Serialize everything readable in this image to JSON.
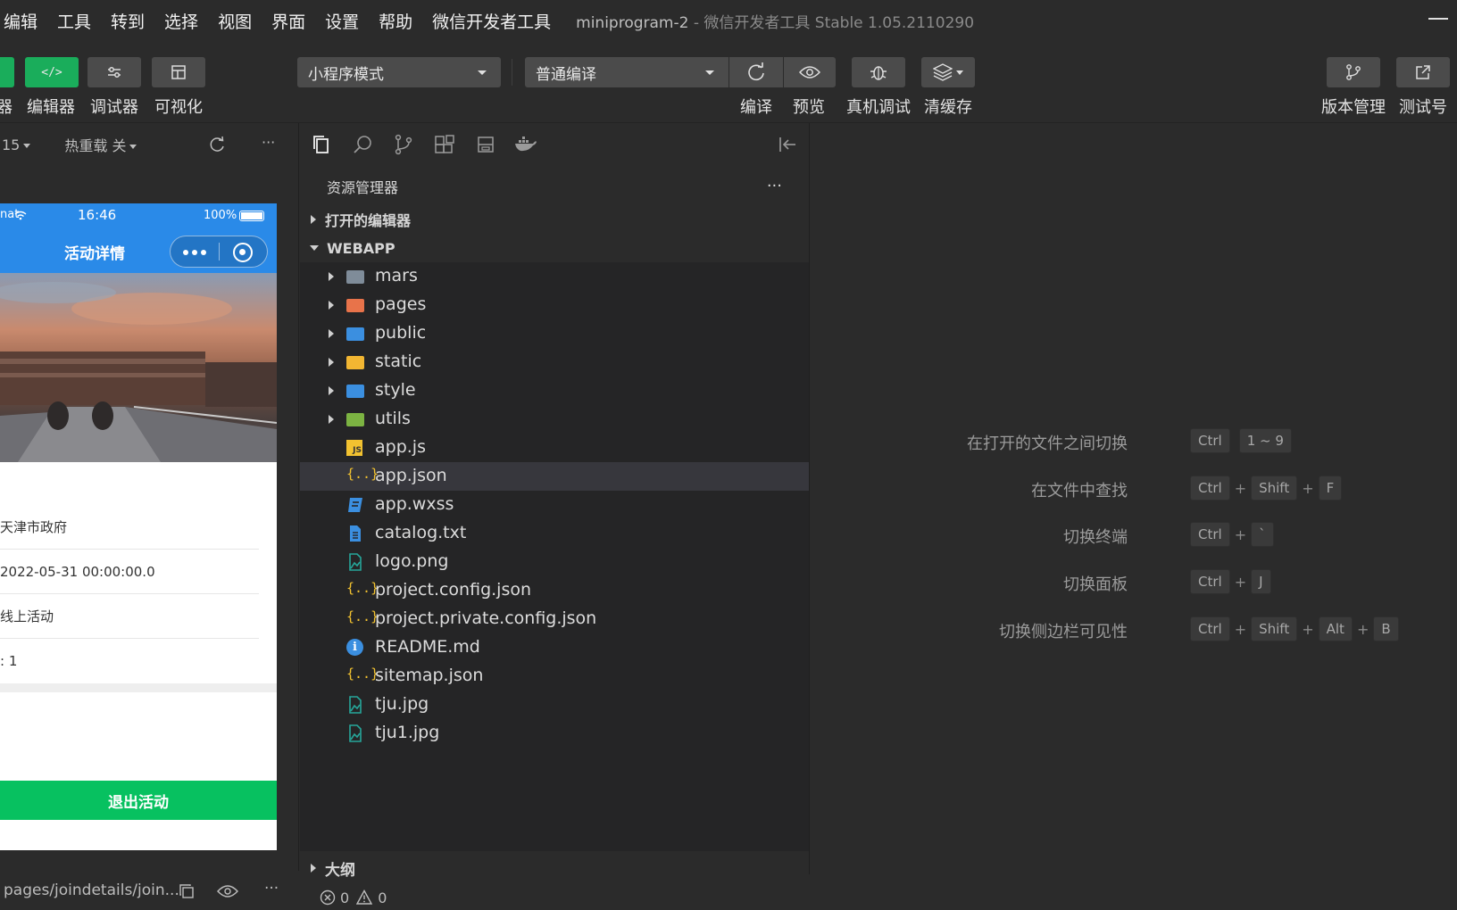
{
  "menu": [
    "编辑",
    "工具",
    "转到",
    "选择",
    "视图",
    "界面",
    "设置",
    "帮助",
    "微信开发者工具"
  ],
  "window": {
    "project": "miniprogram-2",
    "separator": "-",
    "app": "微信开发者工具 Stable 1.05.2110290"
  },
  "toolbar": {
    "simulator_label": "器",
    "editor_label": "编辑器",
    "debugger_label": "调试器",
    "visual_label": "可视化",
    "mode_select": "小程序模式",
    "compile_select": "普通编译",
    "compile_label": "编译",
    "preview_label": "预览",
    "device_debug_label": "真机调试",
    "clear_cache_label": "清缓存",
    "version_label": "版本管理",
    "test_label": "测试号",
    "editor_icon": "</>"
  },
  "simulator": {
    "zoom": "15",
    "hot_reload": "热重载 关",
    "more": "···",
    "status": {
      "carrier": "nat",
      "time": "16:46",
      "battery": "100%"
    },
    "page_title": "活动详情",
    "rows": [
      "天津市政府",
      "2022-05-31 00:00:00.0",
      "线上活动",
      ": 1"
    ],
    "exit_button": "退出活动",
    "path": "pages/joindetails/join..."
  },
  "explorer": {
    "title": "资源管理器",
    "more": "···",
    "open_editors": "打开的编辑器",
    "root": "WEBAPP",
    "folders": [
      {
        "name": "mars",
        "color": "#7f8c99"
      },
      {
        "name": "pages",
        "color": "#e8734a"
      },
      {
        "name": "public",
        "color": "#3b8fe0"
      },
      {
        "name": "static",
        "color": "#f2b632"
      },
      {
        "name": "style",
        "color": "#3b8fe0"
      },
      {
        "name": "utils",
        "color": "#7cb342"
      }
    ],
    "files": [
      "app.js",
      "app.json",
      "app.wxss",
      "catalog.txt",
      "logo.png",
      "project.config.json",
      "project.private.config.json",
      "README.md",
      "sitemap.json",
      "tju.jpg",
      "tju1.jpg"
    ],
    "outline": "大纲",
    "errors": "0",
    "warnings": "0"
  },
  "shortcuts": [
    {
      "label": "在打开的文件之间切换",
      "keys": [
        "Ctrl",
        "1 ~ 9"
      ],
      "joins": [
        " "
      ]
    },
    {
      "label": "在文件中查找",
      "keys": [
        "Ctrl",
        "Shift",
        "F"
      ],
      "joins": [
        "+",
        "+"
      ]
    },
    {
      "label": "切换终端",
      "keys": [
        "Ctrl",
        "`"
      ],
      "joins": [
        "+"
      ]
    },
    {
      "label": "切换面板",
      "keys": [
        "Ctrl",
        "J"
      ],
      "joins": [
        "+"
      ]
    },
    {
      "label": "切换侧边栏可见性",
      "keys": [
        "Ctrl",
        "Shift",
        "Alt",
        "B"
      ],
      "joins": [
        "+",
        "+",
        "+"
      ]
    }
  ],
  "colors": {
    "green": "#1aad5b",
    "wechat_green": "#07c160",
    "blue": "#2a8ae8"
  }
}
